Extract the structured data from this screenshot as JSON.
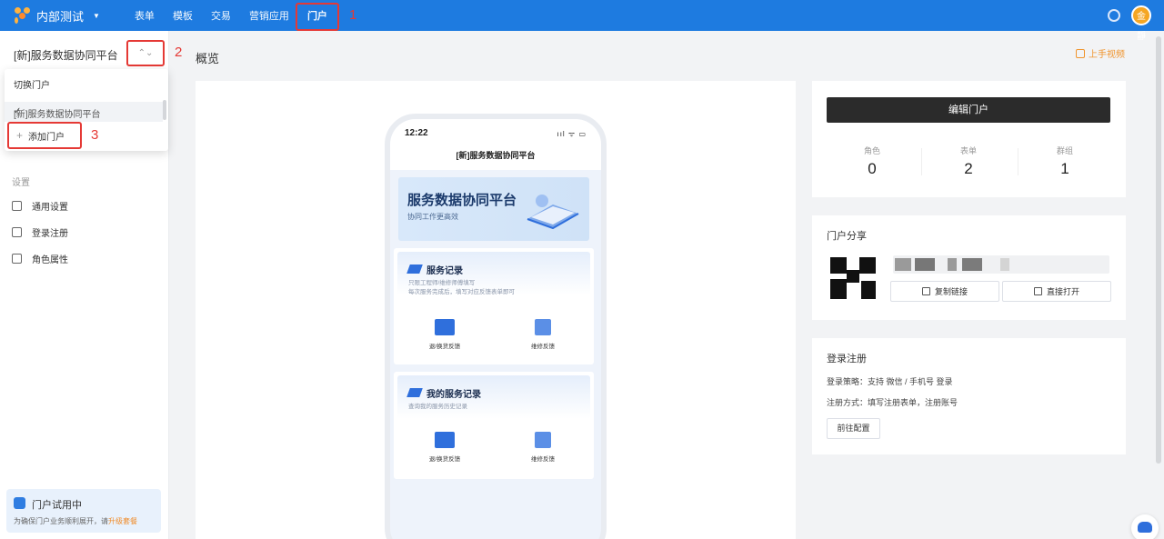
{
  "topbar": {
    "app_name": "内部测试",
    "nav": [
      "表单",
      "模板",
      "交易",
      "营销应用",
      "门户"
    ],
    "active_nav": "门户",
    "annotation_1": "1",
    "avatar_text": "金靜"
  },
  "sidebar": {
    "portal_name": "[新]服务数据协同平台",
    "annotation_2": "2",
    "dropdown": {
      "title": "切换门户",
      "items": [
        "[新]服务数据协同平台"
      ],
      "add_label": "添加门户",
      "annotation_3": "3"
    },
    "section_label": "设置",
    "menu": [
      "通用设置",
      "登录注册",
      "角色属性"
    ],
    "trial": {
      "title": "门户试用中",
      "desc_prefix": "为确保门户业务顺利展开，请",
      "desc_link": "升级套餐"
    }
  },
  "main": {
    "title": "概览",
    "video_link": "上手视频"
  },
  "phone": {
    "time": "12:22",
    "status": "ııl ᯤ ▭",
    "title": "[新]服务数据协同平台",
    "banner_title": "服务数据协同平台",
    "banner_sub": "协同工作更高效",
    "cards": [
      {
        "title": "服务记录",
        "desc_1": "只限工程师/维修师傅填写",
        "desc_2": "每次服务完成后，填写对应反馈表单即可",
        "items": [
          "退/换货反馈",
          "维修反馈"
        ]
      },
      {
        "title": "我的服务记录",
        "desc_1": "查询我的服务历史记录",
        "items": [
          "退/换货反馈",
          "维修反馈"
        ]
      }
    ]
  },
  "overview": {
    "edit_button": "编辑门户",
    "stats": [
      {
        "label": "角色",
        "value": "0"
      },
      {
        "label": "表单",
        "value": "2"
      },
      {
        "label": "群组",
        "value": "1"
      }
    ]
  },
  "share": {
    "title": "门户分享",
    "copy_link": "复制链接",
    "open_direct": "直接打开"
  },
  "login": {
    "title": "登录注册",
    "strategy": "登录策略：支持 微信 / 手机号 登录",
    "register": "注册方式：填写注册表单，注册账号",
    "goto_button": "前往配置"
  },
  "colors": {
    "brand": "#1e7be0",
    "annotation": "#e53935",
    "accent": "#f0952f"
  }
}
